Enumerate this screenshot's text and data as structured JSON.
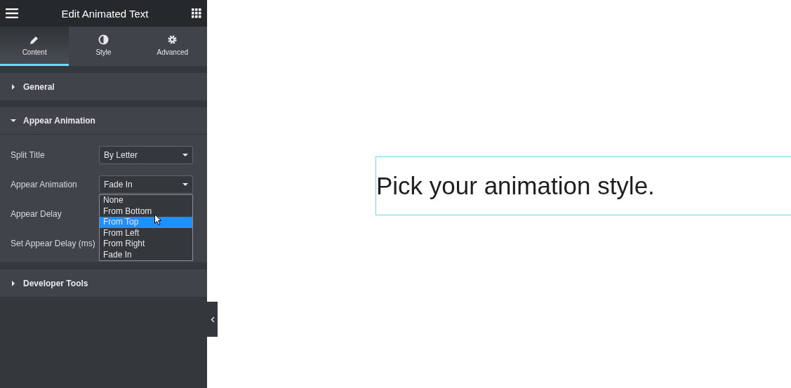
{
  "header": {
    "title": "Edit Animated Text"
  },
  "tabs": [
    {
      "label": "Content",
      "selected": true
    },
    {
      "label": "Style",
      "selected": false
    },
    {
      "label": "Advanced",
      "selected": false
    }
  ],
  "sections": [
    {
      "title": "General",
      "expanded": false
    },
    {
      "title": "Appear Animation",
      "expanded": true,
      "fields": [
        {
          "label": "Split Title",
          "value": "By Letter",
          "open": false
        },
        {
          "label": "Appear Animation",
          "value": "Fade In",
          "open": true,
          "options": [
            {
              "label": "None",
              "highlighted": false
            },
            {
              "label": "From Bottom",
              "highlighted": false
            },
            {
              "label": "From Top",
              "highlighted": true
            },
            {
              "label": "From Left",
              "highlighted": false
            },
            {
              "label": "From Right",
              "highlighted": false
            },
            {
              "label": "Fade In",
              "highlighted": false
            }
          ]
        },
        {
          "label": "Appear Delay"
        },
        {
          "label": "Set Appear Delay (ms)"
        }
      ]
    },
    {
      "title": "Developer Tools",
      "expanded": false
    }
  ],
  "canvas": {
    "heading": "Pick your animation style."
  }
}
